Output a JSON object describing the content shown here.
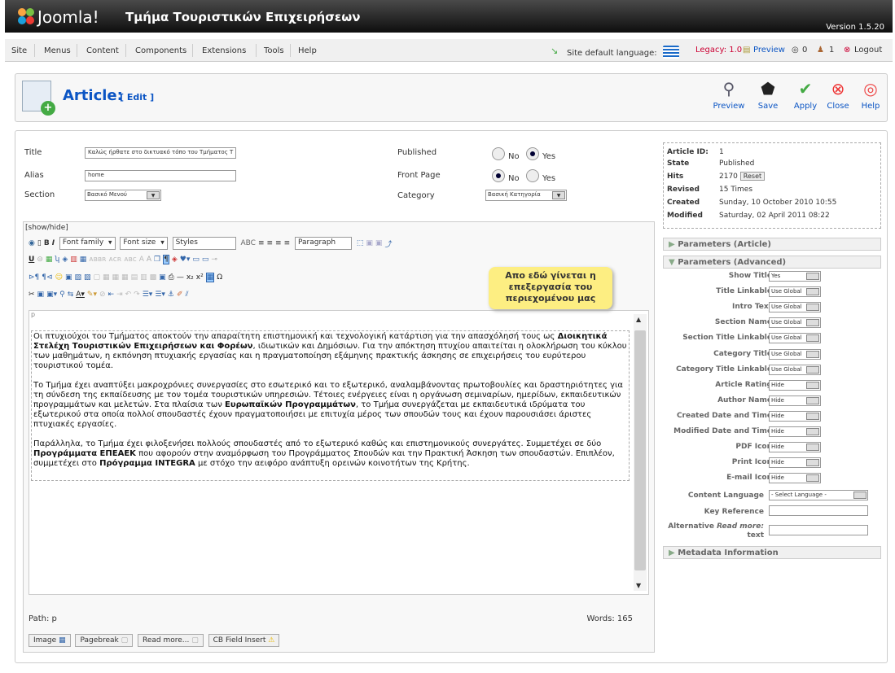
{
  "header": {
    "brand": "Joomla!",
    "site_name": "Τμήμα Τουριστικών Επιχειρήσεων",
    "version": "Version 1.5.20"
  },
  "menu": {
    "items": [
      "Site",
      "Menus",
      "Content",
      "Components",
      "Extensions",
      "Tools",
      "Help"
    ]
  },
  "status": {
    "language_label": "Site default language:",
    "legacy": "Legacy: 1.0",
    "preview": "Preview",
    "messages": "0",
    "users": "1",
    "logout": "Logout"
  },
  "toolbar": {
    "title": "Article:",
    "subtitle": "[ Edit ]",
    "buttons": [
      "Preview",
      "Save",
      "Apply",
      "Close",
      "Help"
    ]
  },
  "form": {
    "title_label": "Title",
    "title_value": "Καλώς ήρθατε στο δικτυακό τόπο του Τμήματος Τ",
    "alias_label": "Alias",
    "alias_value": "home",
    "section_label": "Section",
    "section_value": "Βασικό Μενού",
    "published_label": "Published",
    "frontpage_label": "Front Page",
    "no": "No",
    "yes": "Yes",
    "category_label": "Category",
    "category_value": "Βασική Κατηγορία"
  },
  "editor": {
    "showhide": "[show/hide]",
    "font_family": "Font family",
    "font_size": "Font size",
    "styles": "Styles",
    "paragraph": "Paragraph",
    "p1_a": "Οι πτυχιούχοι του Τμήματος αποκτούν την απαραίτητη επιστημονική και τεχνολογική κατάρτιση για την απασχόλησή τους ως ",
    "p1_b": "Διοικητικά Στελέχη Τουριστικών Επιχειρήσεων και Φορέων",
    "p1_c": ", ιδιωτικών και Δημόσιων. Για την απόκτηση πτυχίου απαιτείται η ολοκλήρωση του κύκλου των μαθημάτων, η εκπόνηση πτυχιακής εργασίας και η πραγματοποίηση εξάμηνης πρακτικής άσκησης σε επιχειρήσεις του ευρύτερου τουριστικού τομέα.",
    "p2_a": "Το Τμήμα έχει αναπτύξει μακροχρόνιες συνεργασίες στο εσωτερικό και το εξωτερικό, αναλαμβάνοντας πρωτοβουλίες και δραστηριότητες για τη σύνδεση της εκπαίδευσης με τον τομέα τουριστικών υπηρεσιών. Τέτοιες ενέργειες είναι η οργάνωση σεμιναρίων, ημερίδων, εκπαιδευτικών προγραμμάτων και μελετών. Στα πλαίσια των ",
    "p2_b": "Ευρωπαϊκών Προγραμμάτων",
    "p2_c": ", το Τμήμα συνεργάζεται με εκπαιδευτικά ιδρύματα του εξωτερικού στα οποία πολλοί σπουδαστές έχουν πραγματοποιήσει με επιτυχία μέρος των σπουδών τους και έχουν παρουσιάσει άριστες πτυχιακές εργασίες.",
    "p3_a": "Παράλληλα, το Τμήμα έχει φιλοξενήσει πολλούς σπουδαστές από το εξωτερικό καθώς και επιστημονικούς συνεργάτες. Συμμετέχει σε δύο ",
    "p3_b": "Προγράμματα ΕΠΕΑΕΚ",
    "p3_c": " που αφορούν στην αναμόρφωση του Προγράμματος Σπουδών και την Πρακτική Άσκηση των σπουδαστών. Επιπλέον, συμμετέχει στο ",
    "p3_d": "Πρόγραμμα INTEGRA",
    "p3_e": " με στόχο την αειφόρο ανάπτυξη ορεινών κοινοτήτων της Κρήτης.",
    "path": "Path: p",
    "words": "Words: 165",
    "buttons": [
      "Image",
      "Pagebreak",
      "Read more...",
      "CB Field Insert"
    ],
    "callout": "Απο εδώ γίνεται η επεξεργασία του περιεχομένου μας"
  },
  "meta": {
    "id_label": "Article ID:",
    "id": "1",
    "state_label": "State",
    "state": "Published",
    "hits_label": "Hits",
    "hits": "2170",
    "reset": "Reset",
    "revised_label": "Revised",
    "revised": "15 Times",
    "created_label": "Created",
    "created": "Sunday, 10 October 2010 10:55",
    "modified_label": "Modified",
    "modified": "Saturday, 02 April 2011 08:22"
  },
  "params": {
    "article_hdr": "Parameters (Article)",
    "advanced_hdr": "Parameters (Advanced)",
    "metadata_hdr": "Metadata Information",
    "rows": [
      {
        "label": "Show Title",
        "value": "Yes"
      },
      {
        "label": "Title Linkable",
        "value": "Use Global"
      },
      {
        "label": "Intro Text",
        "value": "Use Global"
      },
      {
        "label": "Section Name",
        "value": "Use Global"
      },
      {
        "label": "Section Title Linkable",
        "value": "Use Global"
      },
      {
        "label": "Category Title",
        "value": "Use Global"
      },
      {
        "label": "Category Title Linkable",
        "value": "Use Global"
      },
      {
        "label": "Article Rating",
        "value": "Hide"
      },
      {
        "label": "Author Name",
        "value": "Hide"
      },
      {
        "label": "Created Date and Time",
        "value": "Hide"
      },
      {
        "label": "Modified Date and Time",
        "value": "Hide"
      },
      {
        "label": "PDF Icon",
        "value": "Hide"
      },
      {
        "label": "Print Icon",
        "value": "Hide"
      },
      {
        "label": "E-mail Icon",
        "value": "Hide"
      }
    ],
    "content_language_label": "Content Language",
    "content_language_value": "- Select Language -",
    "key_reference_label": "Key Reference",
    "alt_readmore_label_a": "Alternative ",
    "alt_readmore_label_b": "Read more:",
    "alt_readmore_label_c": " text"
  }
}
